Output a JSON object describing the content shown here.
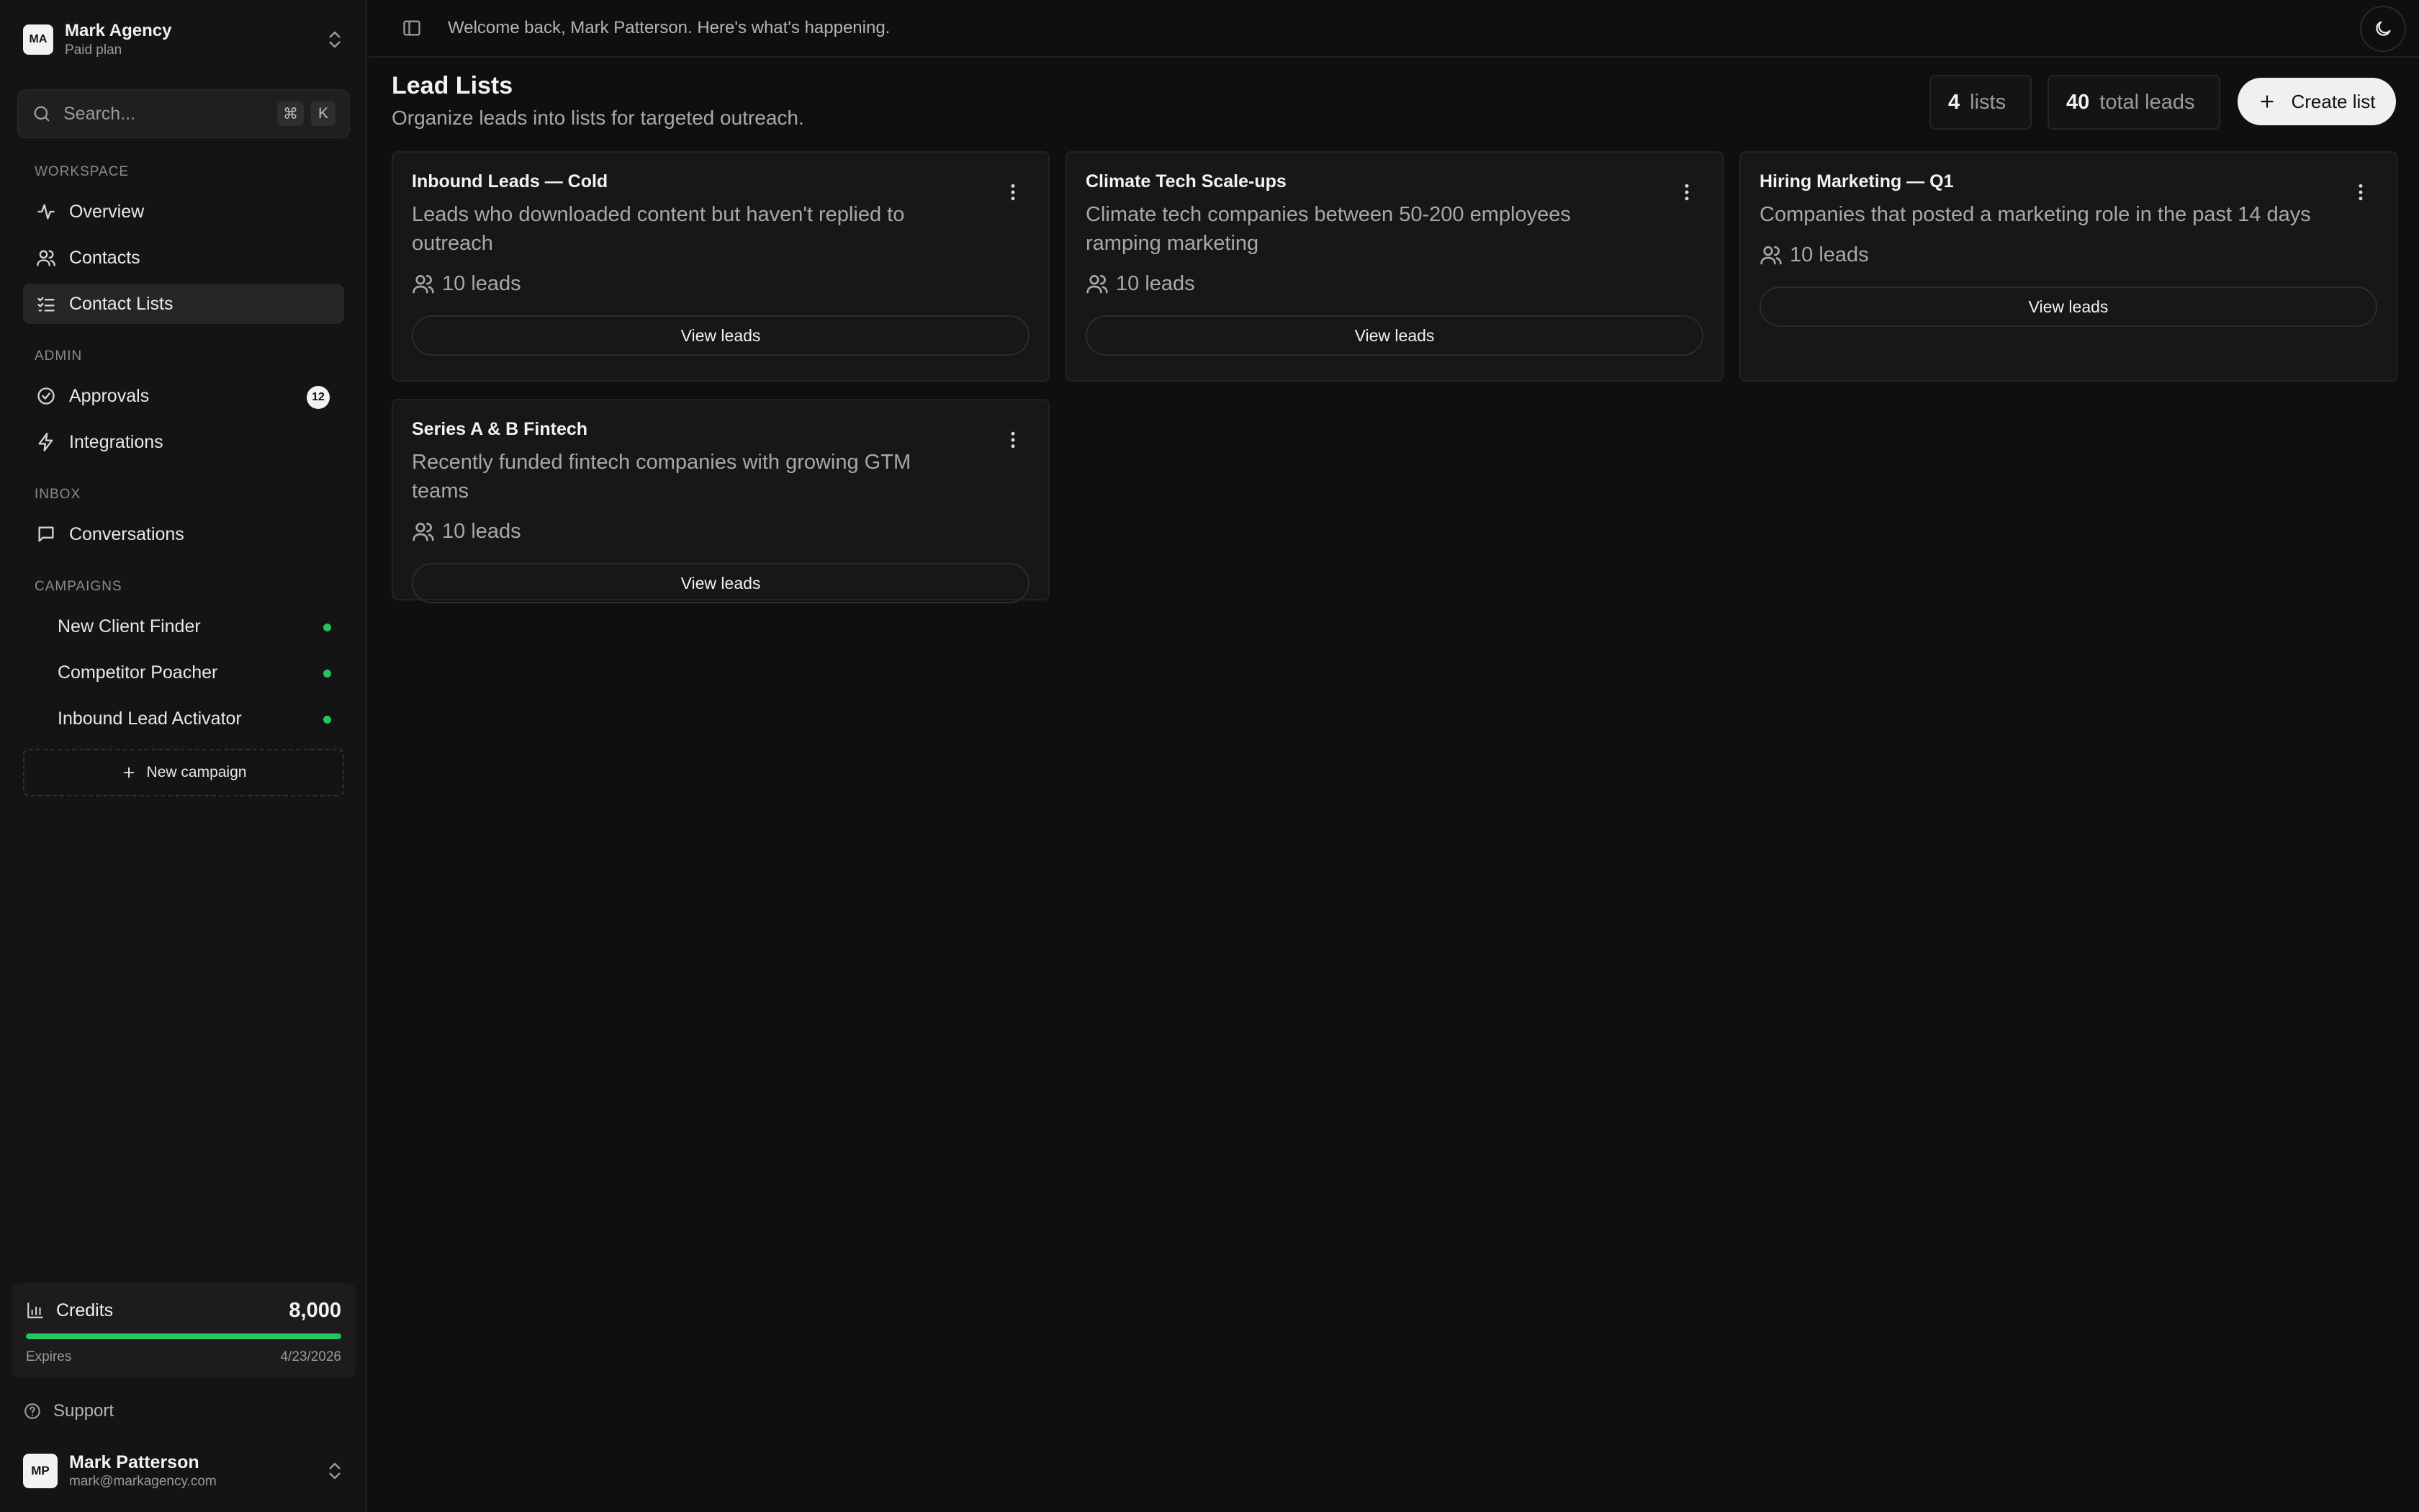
{
  "team": {
    "initials": "MA",
    "name": "Mark Agency",
    "plan": "Paid plan"
  },
  "search": {
    "placeholder": "Search...",
    "kbd_mod": "⌘",
    "kbd_key": "K"
  },
  "sidebar": {
    "workspace_label": "WORKSPACE",
    "workspace_items": [
      {
        "label": "Overview",
        "icon": "activity-icon"
      },
      {
        "label": "Contacts",
        "icon": "users-icon"
      },
      {
        "label": "Contact Lists",
        "icon": "list-checks-icon",
        "active": true
      }
    ],
    "admin_label": "ADMIN",
    "admin_items": [
      {
        "label": "Approvals",
        "icon": "check-circle-icon",
        "badge": "12"
      },
      {
        "label": "Integrations",
        "icon": "zap-icon"
      }
    ],
    "inbox_label": "INBOX",
    "inbox_items": [
      {
        "label": "Conversations",
        "icon": "message-square-icon"
      }
    ],
    "campaigns_label": "CAMPAIGNS",
    "campaigns": [
      {
        "label": "New Client Finder",
        "status_color": "#22c55e"
      },
      {
        "label": "Competitor Poacher",
        "status_color": "#22c55e"
      },
      {
        "label": "Inbound Lead Activator",
        "status_color": "#22c55e"
      }
    ],
    "new_campaign_label": "New campaign"
  },
  "credits": {
    "label": "Credits",
    "value": "8,000",
    "progress": 1.0,
    "expires_label": "Expires",
    "expires_date": "4/23/2026"
  },
  "support_label": "Support",
  "user": {
    "initials": "MP",
    "name": "Mark Patterson",
    "email": "mark@markagency.com"
  },
  "topbar": {
    "welcome": "Welcome back, Mark Patterson. Here's what's happening."
  },
  "page": {
    "title": "Lead Lists",
    "subtitle": "Organize leads into lists for targeted outreach.",
    "stats": {
      "lists_value": "4",
      "lists_label": "lists",
      "leads_value": "40",
      "leads_label": "total leads"
    },
    "create_label": "Create list"
  },
  "lists": [
    {
      "title": "Inbound Leads — Cold",
      "description": "Leads who downloaded content but haven't replied to outreach",
      "count": "10 leads",
      "action": "View leads"
    },
    {
      "title": "Climate Tech Scale-ups",
      "description": "Climate tech companies between 50-200 employees ramping marketing",
      "count": "10 leads",
      "action": "View leads"
    },
    {
      "title": "Hiring Marketing — Q1",
      "description": "Companies that posted a marketing role in the past 14 days",
      "count": "10 leads",
      "action": "View leads"
    },
    {
      "title": "Series A & B Fintech",
      "description": "Recently funded fintech companies with growing GTM teams",
      "count": "10 leads",
      "action": "View leads"
    }
  ],
  "colors": {
    "accent": "#22c55e",
    "background": "#0f0f0f",
    "sidebar": "#141414",
    "card": "#171717"
  }
}
